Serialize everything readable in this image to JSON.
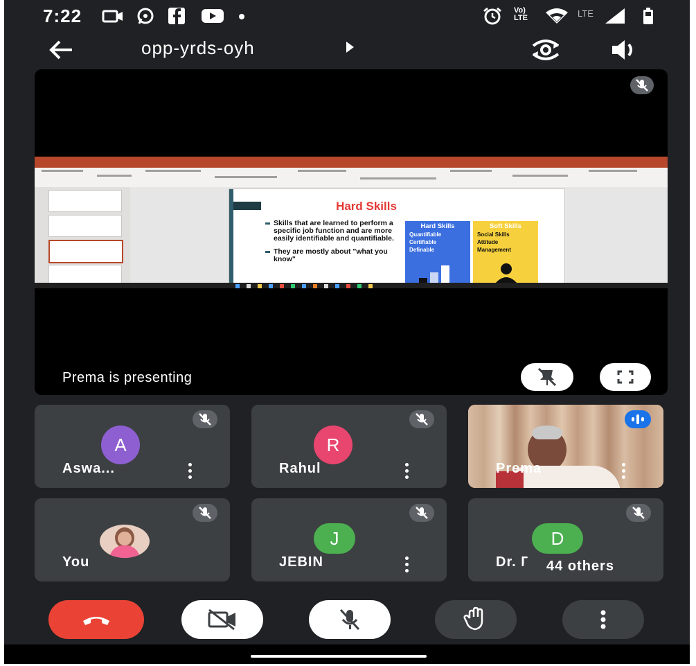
{
  "status_bar": {
    "time": "7:22",
    "left_icons": [
      "video-icon",
      "whatsapp-icon",
      "facebook-icon",
      "youtube-icon",
      "dot-icon"
    ],
    "right_icons": [
      "alarm-icon",
      "volte-icon",
      "wifi-icon",
      "signal-icon",
      "battery-icon"
    ],
    "volte_label": "Vo))\nLTE",
    "lte_label": "LTE"
  },
  "header": {
    "meeting_code": "opp-yrds-oyh",
    "back_icon": "arrow-left-icon",
    "switch_camera_icon": "switch-camera-icon",
    "audio_icon": "speaker-icon"
  },
  "presentation": {
    "caption": "Prema is presenting",
    "slide": {
      "title": "Hard Skills",
      "bullets": [
        "Skills that are learned to perform a specific job function and are more easily identifiable and quantifiable.",
        "They are mostly about \"what you know\""
      ],
      "hard_skills_box": {
        "heading": "Hard Skills",
        "items": [
          "Quantifiable",
          "Certifiable",
          "Definable"
        ]
      },
      "soft_skills_box": {
        "heading": "Soft Skills",
        "items": [
          "Social Skills",
          "Attitude",
          "Management"
        ]
      }
    }
  },
  "participants": [
    {
      "name": "Aswa...",
      "initial": "A",
      "color": "#8e5fd1",
      "muted": true
    },
    {
      "name": "Rahul",
      "initial": "R",
      "color": "#e8456f",
      "muted": true
    },
    {
      "name": "Prema",
      "initial": "",
      "color": "#7a4a3a",
      "muted": false,
      "speaking": true
    },
    {
      "name": "You",
      "initial": "",
      "color": "#d9b5a6",
      "muted": true
    },
    {
      "name": "JEBIN",
      "initial": "J",
      "color": "#4caf50",
      "muted": true
    },
    {
      "name": "Dr. DHANYA",
      "initial": "D",
      "color": "#4caf50",
      "muted": true,
      "overlay": "44 others"
    }
  ],
  "controls": {
    "end_call": "end-call-icon",
    "camera": "camera-off-icon",
    "mic": "mic-off-icon",
    "raise_hand": "raise-hand-icon",
    "more": "more-options-icon"
  },
  "colors": {
    "background": "#202124",
    "tile": "#3c4043",
    "end_call": "#ea4335",
    "speaking_badge": "#1a73e8"
  }
}
